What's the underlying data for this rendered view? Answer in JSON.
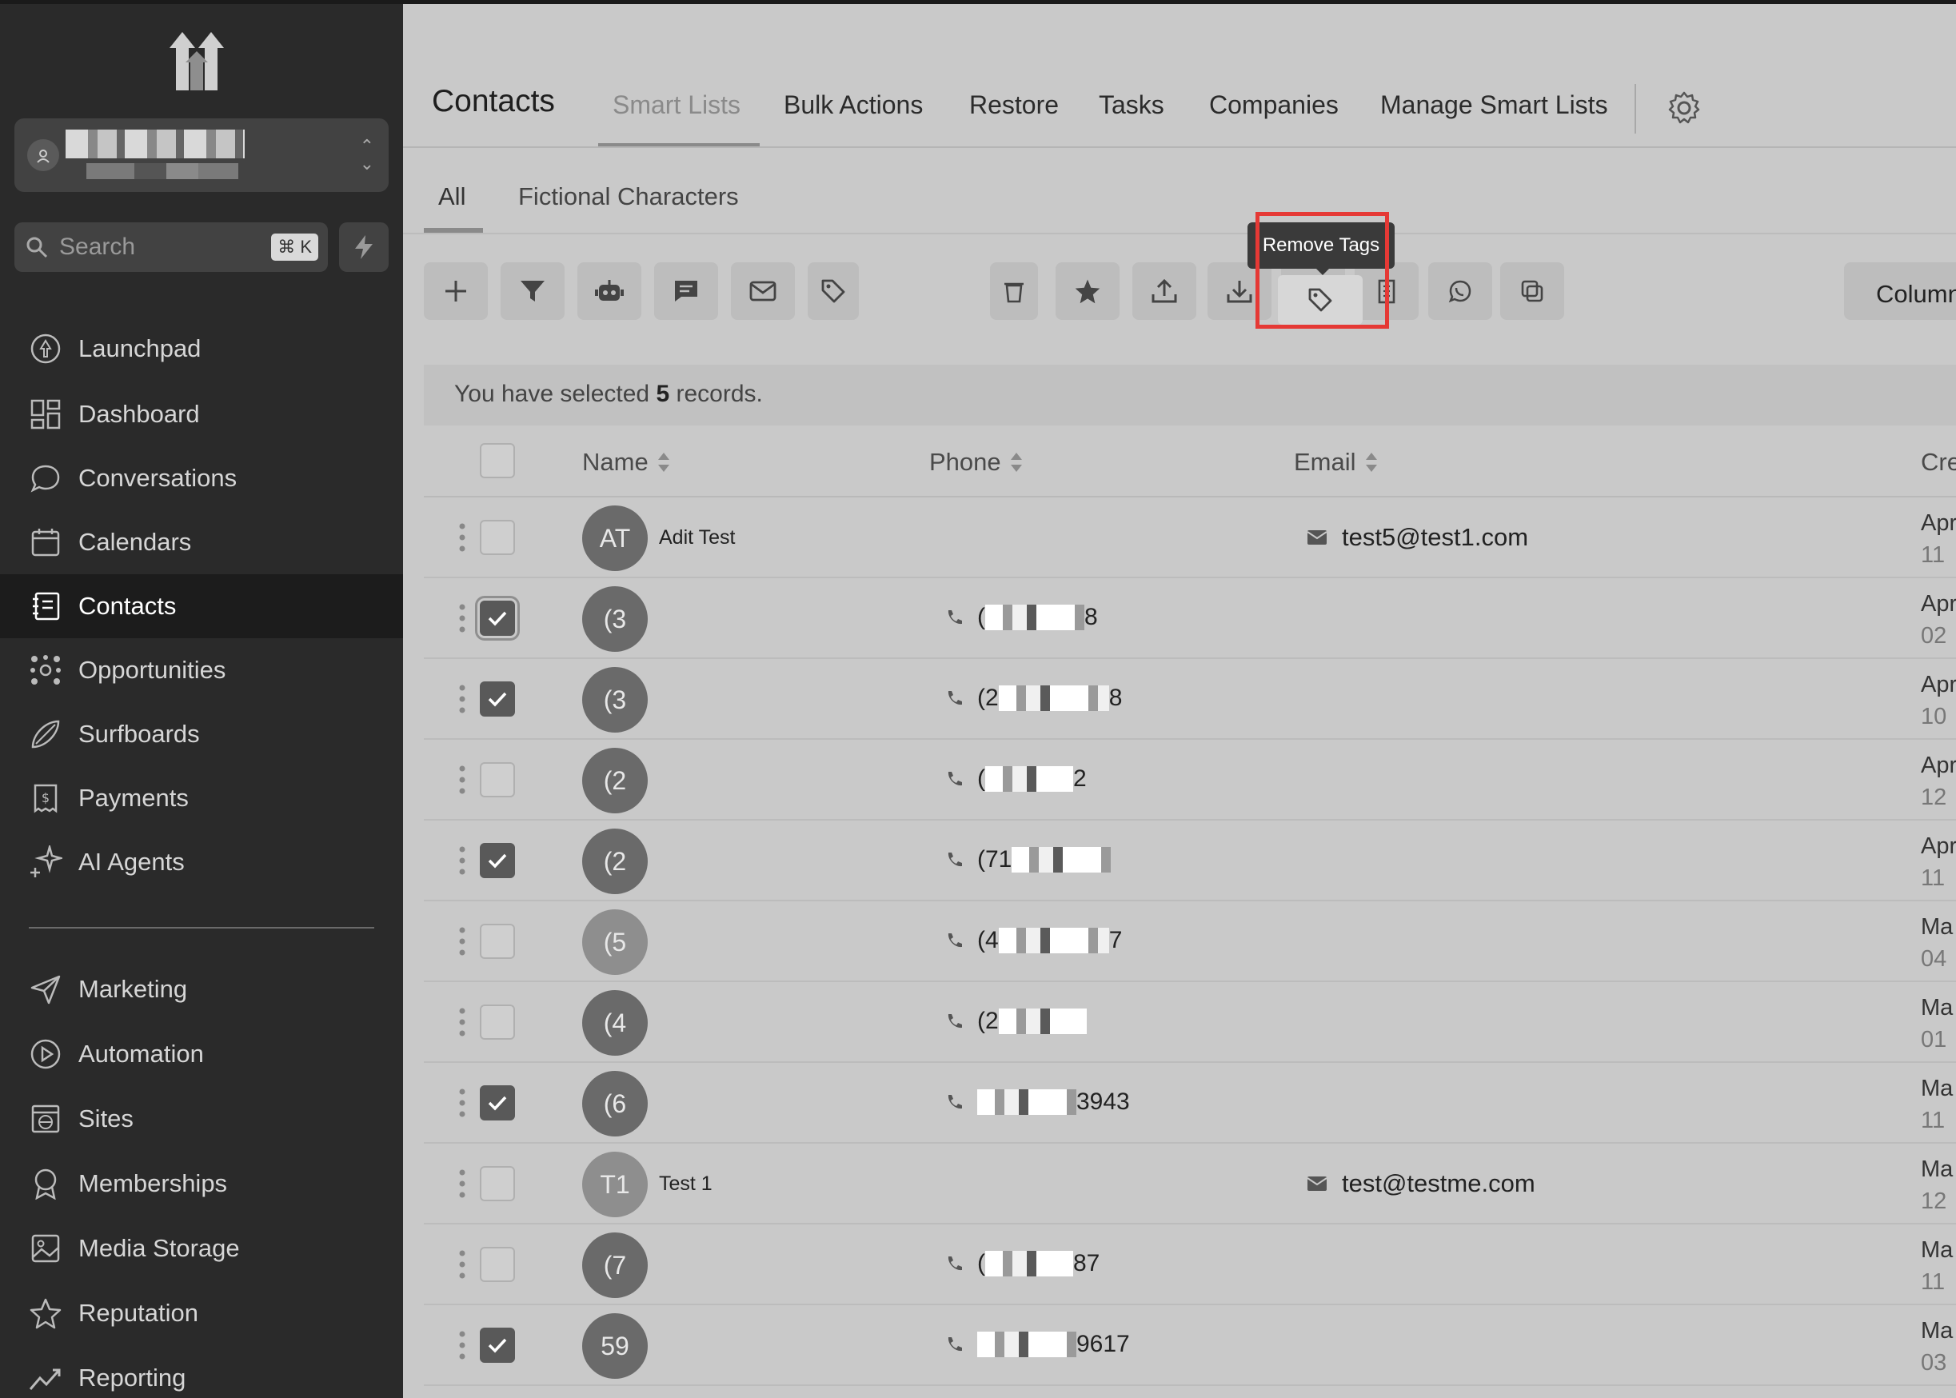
{
  "sidebar": {
    "search_placeholder": "Search",
    "search_shortcut": "⌘ K",
    "nav": [
      {
        "label": "Launchpad",
        "icon": "rocket-icon"
      },
      {
        "label": "Dashboard",
        "icon": "dashboard-icon"
      },
      {
        "label": "Conversations",
        "icon": "chat-icon"
      },
      {
        "label": "Calendars",
        "icon": "calendar-icon"
      },
      {
        "label": "Contacts",
        "icon": "contacts-icon",
        "active": true
      },
      {
        "label": "Opportunities",
        "icon": "opportunities-icon"
      },
      {
        "label": "Surfboards",
        "icon": "surfboard-icon"
      },
      {
        "label": "Payments",
        "icon": "payments-icon"
      },
      {
        "label": "AI Agents",
        "icon": "sparkle-icon"
      }
    ],
    "nav2": [
      {
        "label": "Marketing",
        "icon": "send-icon"
      },
      {
        "label": "Automation",
        "icon": "automation-icon"
      },
      {
        "label": "Sites",
        "icon": "globe-icon"
      },
      {
        "label": "Memberships",
        "icon": "badge-icon"
      },
      {
        "label": "Media Storage",
        "icon": "image-icon"
      },
      {
        "label": "Reputation",
        "icon": "star-icon"
      },
      {
        "label": "Reporting",
        "icon": "chart-icon"
      }
    ]
  },
  "header": {
    "title": "Contacts",
    "tabs": [
      "Smart Lists",
      "Bulk Actions",
      "Restore",
      "Tasks",
      "Companies",
      "Manage Smart Lists"
    ]
  },
  "subtabs": [
    "All",
    "Fictional Characters"
  ],
  "toolbar": {
    "tooltip": "Remove Tags",
    "columns_label": "Column"
  },
  "selection": {
    "prefix": "You have selected",
    "count": "5",
    "suffix": "records."
  },
  "table": {
    "columns": [
      "Name",
      "Phone",
      "Email",
      "Cre"
    ],
    "rows": [
      {
        "initials": "AT",
        "name": "Adit Test",
        "phone_start": "",
        "phone_end": "",
        "email": "test5@test1.com",
        "created": "Apr",
        "created_time": "11",
        "checked": false,
        "light": false
      },
      {
        "initials": "(3",
        "name": "",
        "phone_start": "(",
        "phone_end": "8",
        "email": "",
        "created": "Apr",
        "created_time": "02",
        "checked": true,
        "light": false
      },
      {
        "initials": "(3",
        "name": "",
        "phone_start": "(2",
        "phone_end": "8",
        "email": "",
        "created": "Apr",
        "created_time": "10",
        "checked": true,
        "light": false
      },
      {
        "initials": "(2",
        "name": "",
        "phone_start": "(",
        "phone_end": "2",
        "email": "",
        "created": "Apr",
        "created_time": "12",
        "checked": false,
        "light": false
      },
      {
        "initials": "(2",
        "name": "",
        "phone_start": "(71",
        "phone_end": "",
        "email": "",
        "created": "Apr",
        "created_time": "11",
        "checked": true,
        "light": false
      },
      {
        "initials": "(5",
        "name": "",
        "phone_start": "(4",
        "phone_end": "7",
        "email": "",
        "created": "Ma",
        "created_time": "04",
        "checked": false,
        "light": true
      },
      {
        "initials": "(4",
        "name": "",
        "phone_start": "(2",
        "phone_end": "",
        "email": "",
        "created": "Ma",
        "created_time": "01",
        "checked": false,
        "light": false
      },
      {
        "initials": "(6",
        "name": "",
        "phone_start": "",
        "phone_end": "3943",
        "email": "",
        "created": "Ma",
        "created_time": "11",
        "checked": true,
        "light": false
      },
      {
        "initials": "T1",
        "name": "Test 1",
        "phone_start": "",
        "phone_end": "",
        "email": "test@testme.com",
        "created": "Ma",
        "created_time": "12",
        "checked": false,
        "light": true
      },
      {
        "initials": "(7",
        "name": "",
        "phone_start": "(",
        "phone_end": "87",
        "email": "",
        "created": "Ma",
        "created_time": "11",
        "checked": false,
        "light": false
      },
      {
        "initials": "59",
        "name": "",
        "phone_start": "",
        "phone_end": "9617",
        "email": "",
        "created": "Ma",
        "created_time": "03",
        "checked": true,
        "light": false
      }
    ]
  },
  "colors": {
    "accent_highlight": "#e53935",
    "sidebar_bg": "#2a2a2a",
    "main_bg": "#c9c9c9"
  }
}
